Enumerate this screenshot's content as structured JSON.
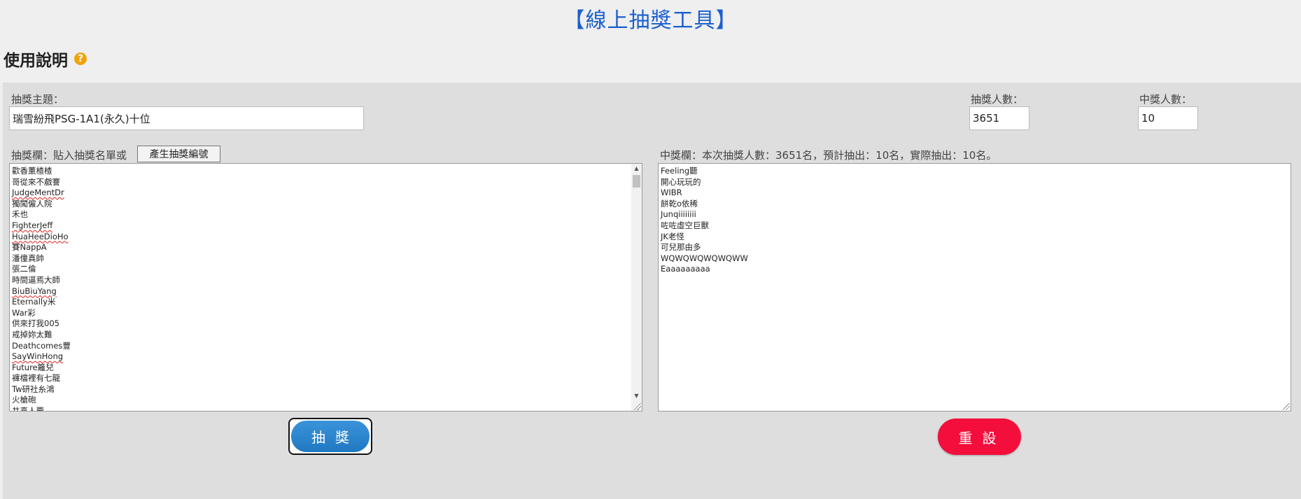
{
  "page_title": "【線上抽獎工具】",
  "usage_heading": "使用說明",
  "help_icon_glyph": "?",
  "topic": {
    "label": "抽獎主題：",
    "value": "瑞雪紛飛PSG-1A1(永久)十位"
  },
  "participants_count": {
    "label": "抽獎人數：",
    "value": "3651"
  },
  "winners_count": {
    "label": "中獎人數：",
    "value": "10"
  },
  "entry_box": {
    "label": "抽獎欄：貼入抽獎名單或",
    "generate_button": "產生抽獎編號",
    "entries": [
      "歡香薰楂楂",
      "哥從來不戲謇",
      "JudgeMentDr",
      "獨闖僱人院",
      "禾也",
      "FighterJeff",
      "HuaHeeDioHo",
      "賽NappA",
      "潘僮真帥",
      "張二倫",
      "時間逼焉大師",
      "BiuBiuYang",
      "Eternally米",
      "War彩",
      "供來打我005",
      "戒掉妳太難",
      "Deathcomes豐",
      "SayWinHong",
      "Future籬兒",
      "褲檔裡有七龍",
      "Tw研社糸鴻",
      "火槍砲",
      "共喜人要"
    ]
  },
  "result_box": {
    "label": "中獎欄：本次抽獎人數：3651名，預計抽出：10名，實際抽出：10名。",
    "winners": [
      "Feeling聽",
      "開心玩玩的",
      "WIBR",
      "餅乾o依稀",
      "Junqiiiiiiii",
      "咗咗虛空巨獸",
      "JK老怪",
      "可兒那由多",
      "WQWQWQWQWQWW",
      "Eaaaaaaaaa"
    ]
  },
  "draw_button_label": "抽獎",
  "reset_button_label": "重設",
  "colors": {
    "title": "#1a5fd0",
    "help_icon": "#f0a30a",
    "draw_button": "#2a86cf",
    "reset_button": "#f40e3c",
    "panel": "#dedede"
  }
}
